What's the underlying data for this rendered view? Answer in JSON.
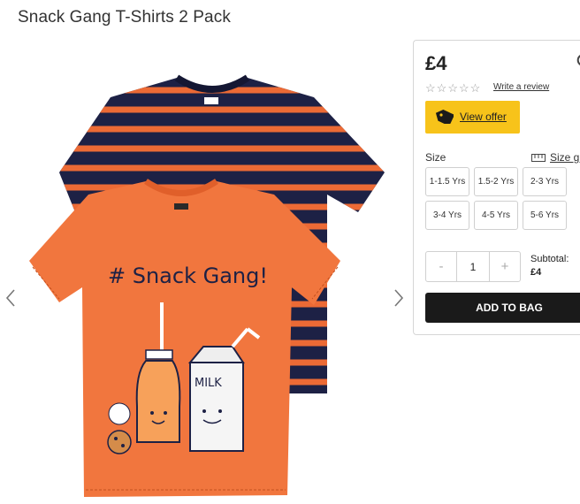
{
  "product": {
    "title": "Snack Gang T-Shirts 2 Pack",
    "price": "£4",
    "image_alt": "Snack Gang T-Shirts 2 Pack",
    "print_text": "# Snack Gang!",
    "carton_text": "MILK"
  },
  "reviews": {
    "stars": 0,
    "write_label": "Write a review"
  },
  "offer": {
    "label": "View offer",
    "color": "#f7c31a"
  },
  "size": {
    "label": "Size",
    "guide_label": "Size gu",
    "options": [
      "1-1.5 Yrs",
      "1.5-2 Yrs",
      "2-3 Yrs",
      "3-4 Yrs",
      "4-5 Yrs",
      "5-6 Yrs"
    ]
  },
  "quantity": {
    "minus": "-",
    "value": "1",
    "plus": "+"
  },
  "subtotal": {
    "label": "Subtotal:",
    "amount": "£4"
  },
  "cart": {
    "add_label": "ADD TO BAG"
  },
  "colors": {
    "orange_shirt": "#f1763e",
    "navy": "#1d2145",
    "button_dark": "#1a1a1a"
  },
  "icons": {
    "prev": "chevron-left-icon",
    "next": "chevron-right-icon",
    "offer": "price-tag-icon",
    "size_guide": "ruler-icon"
  }
}
